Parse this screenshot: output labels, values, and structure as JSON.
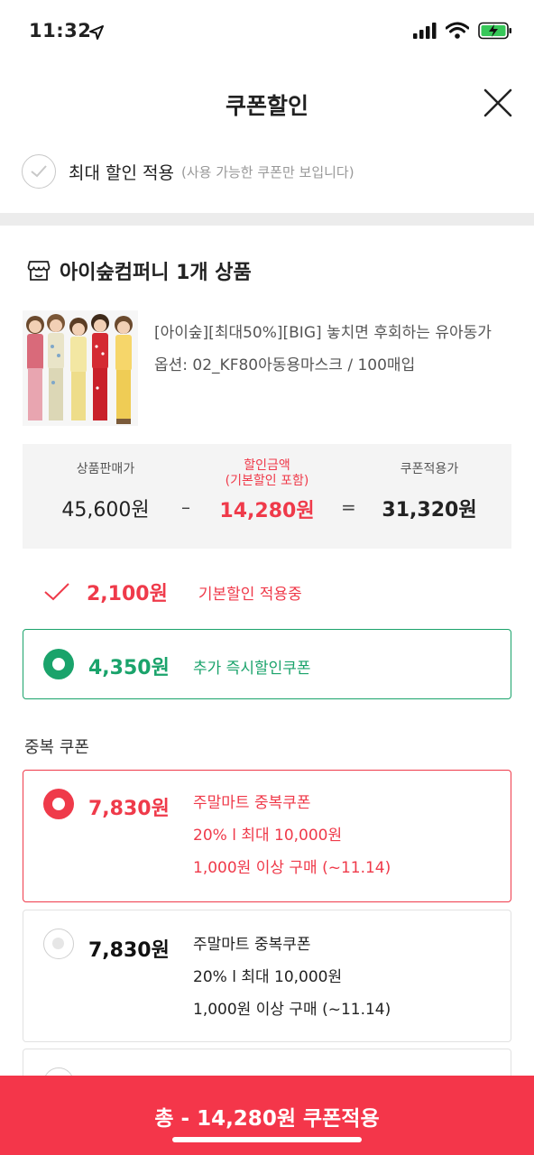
{
  "status": {
    "time": "11:32"
  },
  "header": {
    "title": "쿠폰할인"
  },
  "max_discount": {
    "label": "최대 할인 적용",
    "hint": "(사용 가능한 쿠폰만 보입니다)",
    "checked": false
  },
  "seller": {
    "name": "아이숲컴퍼니 1개 상품"
  },
  "product": {
    "name": "[아이숲][최대50%][BIG] 놓치면 후회하는 유아동가",
    "option": "옵션: 02_KF80아동용마스크 / 100매입"
  },
  "price_summary": {
    "sale_label": "상품판매가",
    "sale_value": "45,600원",
    "minus": "–",
    "discount_label": "할인금액",
    "discount_sublabel": "(기본할인 포함)",
    "discount_value": "14,280원",
    "equals": "=",
    "final_label": "쿠폰적용가",
    "final_value": "31,320원"
  },
  "basic_discount": {
    "amount": "2,100원",
    "label": "기본할인 적용중"
  },
  "instant_coupon": {
    "amount": "4,350원",
    "label": "추가 즉시할인쿠폰",
    "selected": true
  },
  "stack_section_label": "중복 쿠폰",
  "stack_coupons": [
    {
      "amount": "7,830원",
      "title": "주말마트 중복쿠폰",
      "detail": "20% l 최대 10,000원",
      "condition": "1,000원 이상 구매 (~11.14)",
      "selected": true
    },
    {
      "amount": "7,830원",
      "title": "주말마트 중복쿠폰",
      "detail": "20% l 최대 10,000원",
      "condition": "1,000원 이상 구매 (~11.14)",
      "selected": false
    }
  ],
  "cta": {
    "label": "총 - 14,280원 쿠폰적용"
  },
  "colors": {
    "accent_red": "#f4364a",
    "accent_green": "#1aa36b"
  }
}
